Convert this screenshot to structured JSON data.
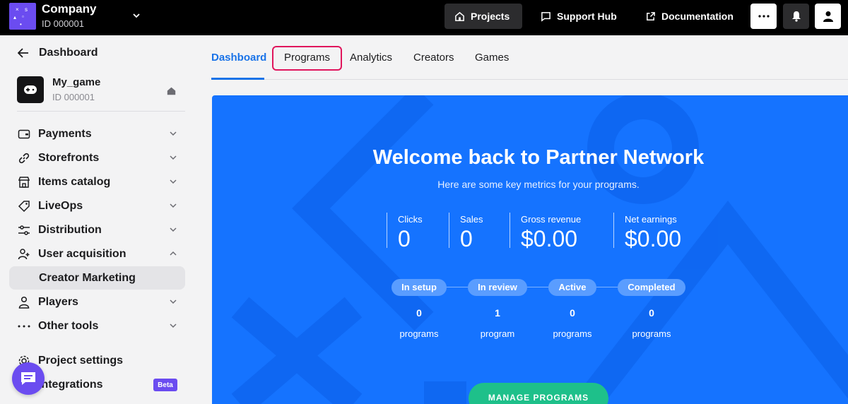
{
  "company": {
    "name": "Company",
    "id": "ID 000001"
  },
  "topnav": {
    "projects": "Projects",
    "support": "Support Hub",
    "docs": "Documentation"
  },
  "sidebar": {
    "back_label": "Dashboard",
    "game": {
      "name": "My_game",
      "id": "ID 000001"
    },
    "items": [
      {
        "label": "Payments",
        "icon": "wallet-icon",
        "chevron": "down"
      },
      {
        "label": "Storefronts",
        "icon": "link-icon",
        "chevron": "down"
      },
      {
        "label": "Items catalog",
        "icon": "store-icon",
        "chevron": "down"
      },
      {
        "label": "LiveOps",
        "icon": "tag-icon",
        "chevron": "down"
      },
      {
        "label": "Distribution",
        "icon": "sliders-icon",
        "chevron": "down"
      },
      {
        "label": "User acquisition",
        "icon": "add-user-icon",
        "chevron": "up"
      },
      {
        "label": "Players",
        "icon": "person-icon",
        "chevron": "down"
      },
      {
        "label": "Other tools",
        "icon": "dots-icon",
        "chevron": "down"
      }
    ],
    "sub_item": "Creator Marketing",
    "project_settings": "Project settings",
    "integrations": "Integrations",
    "beta_badge": "Beta"
  },
  "tabs": [
    "Dashboard",
    "Programs",
    "Analytics",
    "Creators",
    "Games"
  ],
  "hero": {
    "title": "Welcome back to Partner Network",
    "subtitle": "Here are some key metrics for your programs.",
    "metrics": [
      {
        "label": "Clicks",
        "value": "0"
      },
      {
        "label": "Sales",
        "value": "0"
      },
      {
        "label": "Gross revenue",
        "value": "$0.00"
      },
      {
        "label": "Net earnings",
        "value": "$0.00"
      }
    ],
    "stages": [
      {
        "label": "In setup",
        "count": "0",
        "unit": "programs"
      },
      {
        "label": "In review",
        "count": "1",
        "unit": "program"
      },
      {
        "label": "Active",
        "count": "0",
        "unit": "programs"
      },
      {
        "label": "Completed",
        "count": "0",
        "unit": "programs"
      }
    ],
    "cta": "MANAGE PROGRAMS"
  },
  "colors": {
    "accent": "#1a73e8",
    "hero": "#1573ff",
    "brand": "#6b4cf0",
    "cta": "#1ec08a",
    "highlight": "#e0155c"
  }
}
